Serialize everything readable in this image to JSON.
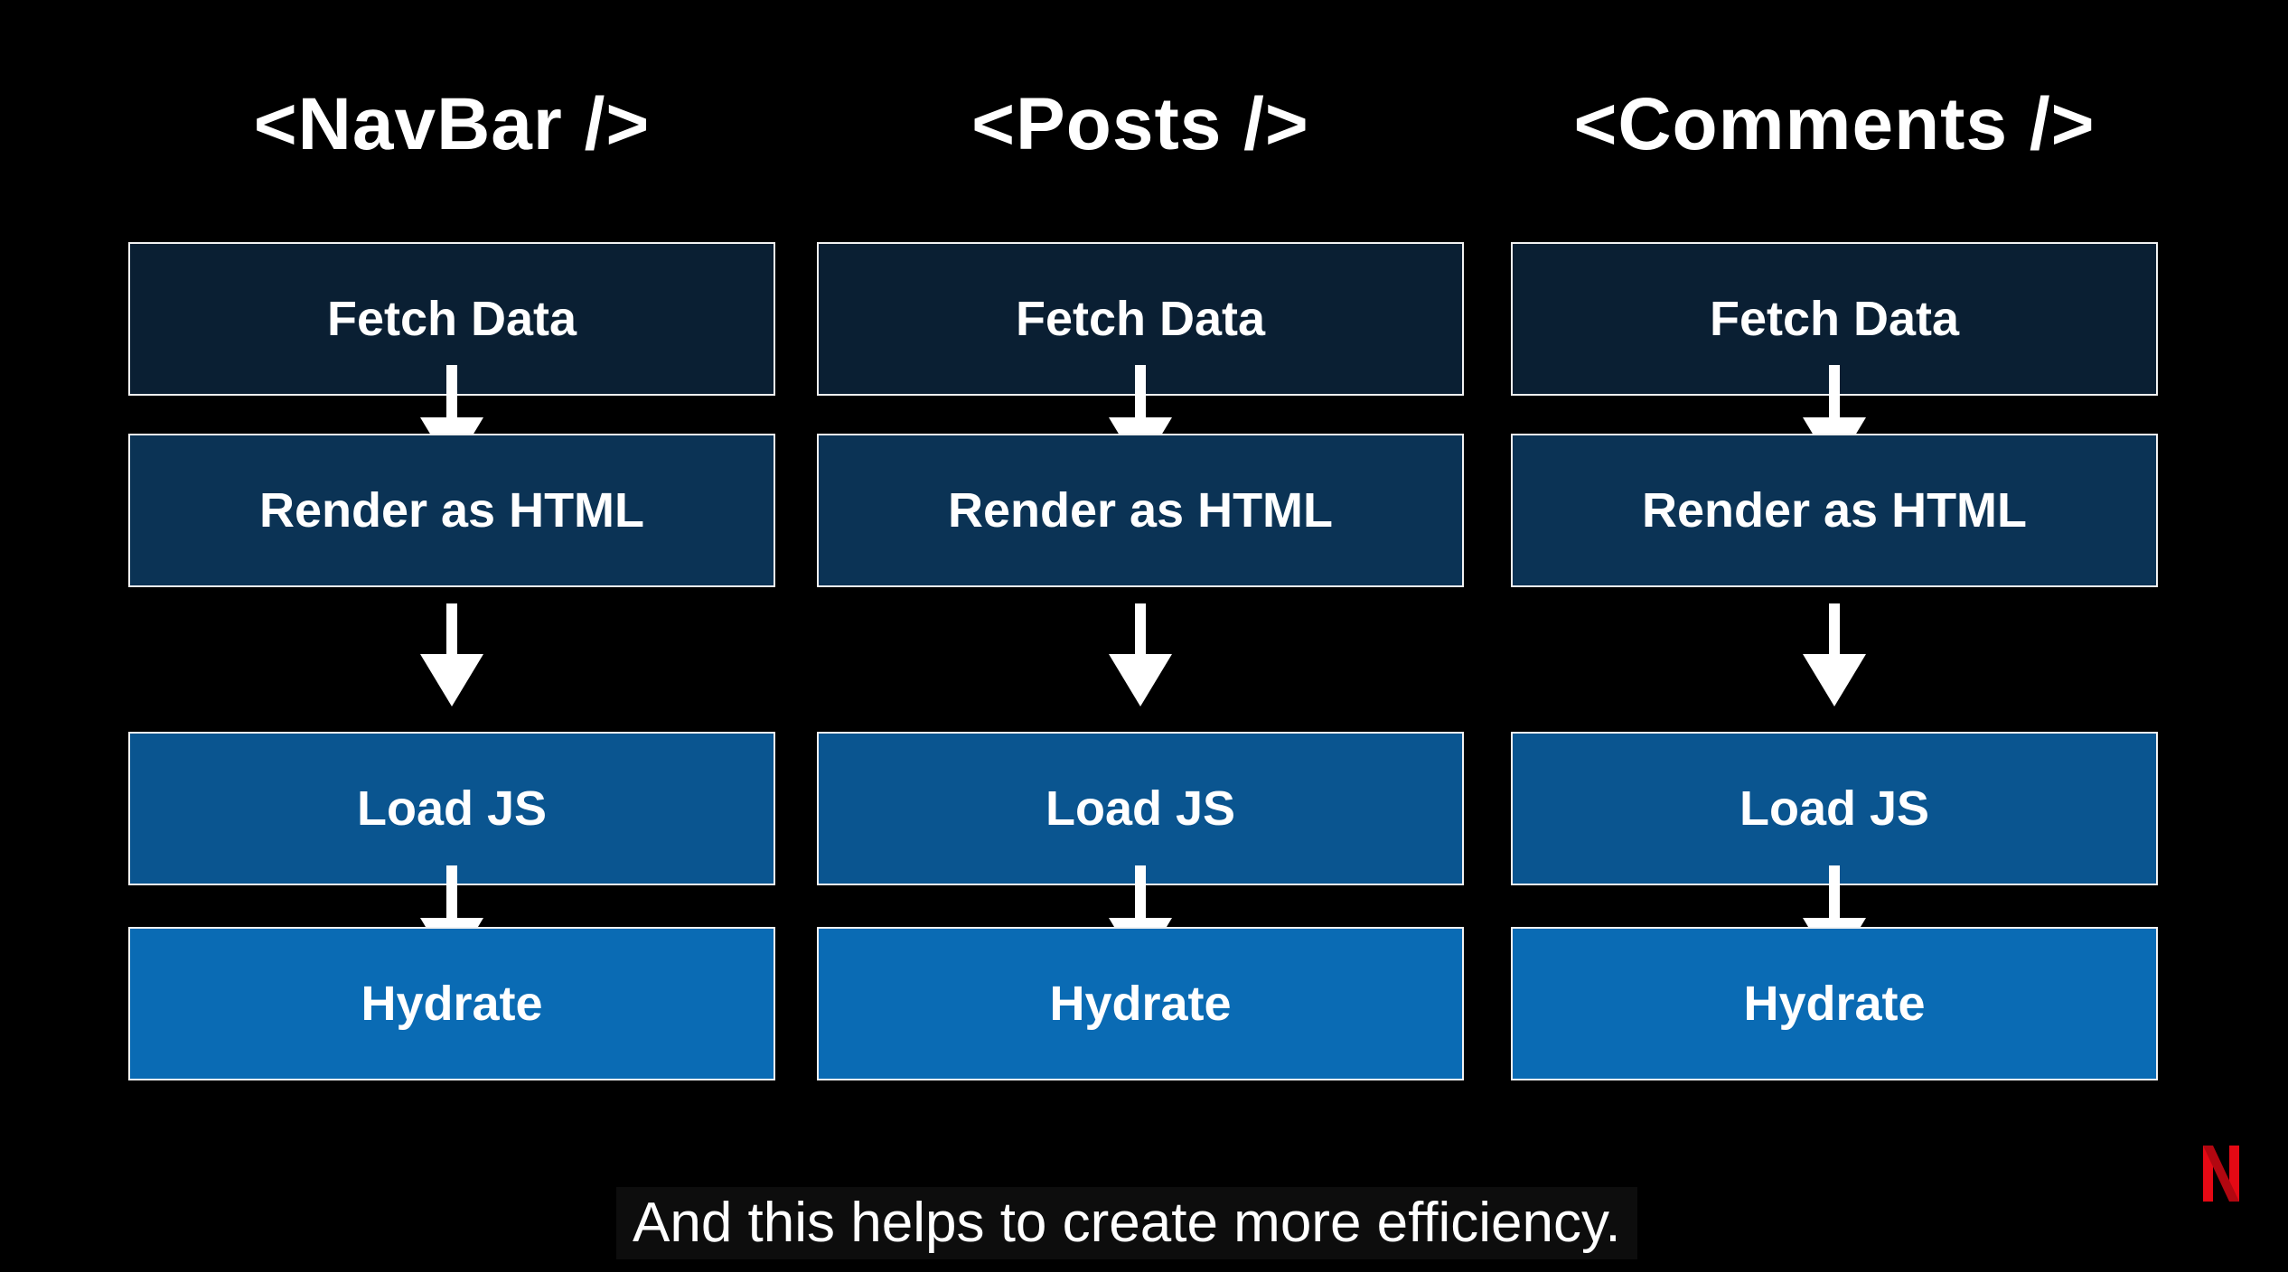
{
  "colors": {
    "background": "#000000",
    "fetch_box": "#0a1f33",
    "render_box": "#0b3355",
    "load_box": "#0a5590",
    "hydrate_box": "#0a6bb4",
    "border": "#f2f2f2",
    "text": "#ffffff",
    "logo": "#e50914"
  },
  "columns": [
    {
      "title": "<NavBar />",
      "steps": {
        "fetch": "Fetch Data",
        "render": "Render as HTML",
        "load": "Load JS",
        "hydrate": "Hydrate"
      }
    },
    {
      "title": "<Posts />",
      "steps": {
        "fetch": "Fetch Data",
        "render": "Render as HTML",
        "load": "Load JS",
        "hydrate": "Hydrate"
      }
    },
    {
      "title": "<Comments />",
      "steps": {
        "fetch": "Fetch Data",
        "render": "Render as HTML",
        "load": "Load JS",
        "hydrate": "Hydrate"
      }
    }
  ],
  "caption": "And this helps to create more efficiency.",
  "logo": {
    "icon": "netflix-n-logo",
    "letter": "N"
  }
}
